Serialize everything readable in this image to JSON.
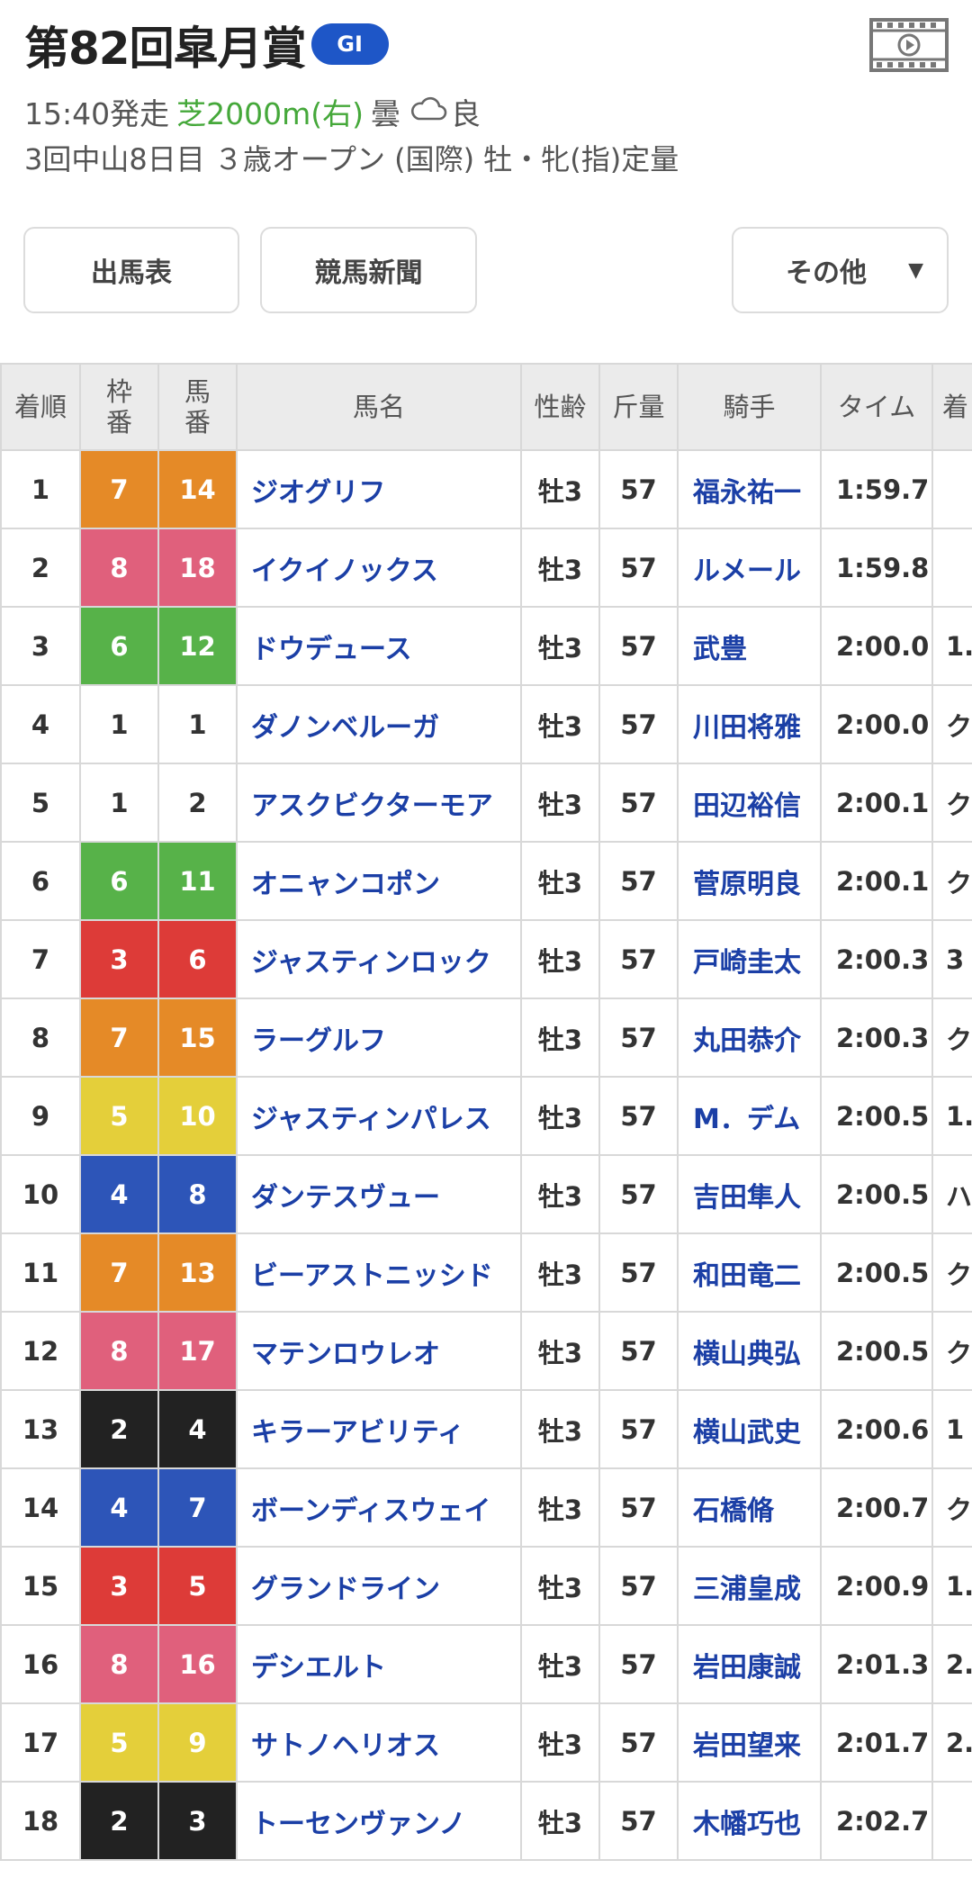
{
  "race": {
    "title": "第82回皐月賞",
    "grade": "GI",
    "start_time": "15:40発走",
    "course": "芝2000m(右)",
    "weather": "曇",
    "weather_icon": "cloud-icon",
    "track_condition": "良",
    "details": "3回中山8日目 ３歳オープン (国際) 牡・牝(指)定量"
  },
  "buttons": {
    "shutuba": "出馬表",
    "shinbun": "競馬新聞",
    "other": "その他",
    "other_caret": "▼"
  },
  "table": {
    "headers": {
      "order": "着順",
      "waku": "枠番",
      "num": "馬番",
      "horse": "馬名",
      "sexage": "性齢",
      "weight": "斤量",
      "jockey": "騎手",
      "time": "タイム",
      "margin": "着"
    },
    "waku_colors": {
      "1": "#ffffff",
      "2": "#222222",
      "3": "#dd3b38",
      "4": "#2d55b8",
      "5": "#e4cf3a",
      "6": "#57b249",
      "7": "#e58a27",
      "8": "#e0607c"
    },
    "rows": [
      {
        "order": "1",
        "waku": "7",
        "num": "14",
        "horse": "ジオグリフ",
        "sexage": "牡3",
        "weight": "57",
        "jockey": "福永祐一",
        "time": "1:59.7",
        "margin": ""
      },
      {
        "order": "2",
        "waku": "8",
        "num": "18",
        "horse": "イクイノックス",
        "sexage": "牡3",
        "weight": "57",
        "jockey": "ルメール",
        "time": "1:59.8",
        "margin": ""
      },
      {
        "order": "3",
        "waku": "6",
        "num": "12",
        "horse": "ドウデュース",
        "sexage": "牡3",
        "weight": "57",
        "jockey": "武豊",
        "time": "2:00.0",
        "margin": "1."
      },
      {
        "order": "4",
        "waku": "1",
        "num": "1",
        "horse": "ダノンベルーガ",
        "sexage": "牡3",
        "weight": "57",
        "jockey": "川田将雅",
        "time": "2:00.0",
        "margin": "ク"
      },
      {
        "order": "5",
        "waku": "1",
        "num": "2",
        "horse": "アスクビクターモア",
        "sexage": "牡3",
        "weight": "57",
        "jockey": "田辺裕信",
        "time": "2:00.1",
        "margin": "ク"
      },
      {
        "order": "6",
        "waku": "6",
        "num": "11",
        "horse": "オニャンコポン",
        "sexage": "牡3",
        "weight": "57",
        "jockey": "菅原明良",
        "time": "2:00.1",
        "margin": "ク"
      },
      {
        "order": "7",
        "waku": "3",
        "num": "6",
        "horse": "ジャスティンロック",
        "sexage": "牡3",
        "weight": "57",
        "jockey": "戸崎圭太",
        "time": "2:00.3",
        "margin": "3"
      },
      {
        "order": "8",
        "waku": "7",
        "num": "15",
        "horse": "ラーグルフ",
        "sexage": "牡3",
        "weight": "57",
        "jockey": "丸田恭介",
        "time": "2:00.3",
        "margin": "ク"
      },
      {
        "order": "9",
        "waku": "5",
        "num": "10",
        "horse": "ジャスティンパレス",
        "sexage": "牡3",
        "weight": "57",
        "jockey": "M．デム",
        "time": "2:00.5",
        "margin": "1."
      },
      {
        "order": "10",
        "waku": "4",
        "num": "8",
        "horse": "ダンテスヴュー",
        "sexage": "牡3",
        "weight": "57",
        "jockey": "吉田隼人",
        "time": "2:00.5",
        "margin": "ハ"
      },
      {
        "order": "11",
        "waku": "7",
        "num": "13",
        "horse": "ビーアストニッシド",
        "sexage": "牡3",
        "weight": "57",
        "jockey": "和田竜二",
        "time": "2:00.5",
        "margin": "ク"
      },
      {
        "order": "12",
        "waku": "8",
        "num": "17",
        "horse": "マテンロウレオ",
        "sexage": "牡3",
        "weight": "57",
        "jockey": "横山典弘",
        "time": "2:00.5",
        "margin": "ク"
      },
      {
        "order": "13",
        "waku": "2",
        "num": "4",
        "horse": "キラーアビリティ",
        "sexage": "牡3",
        "weight": "57",
        "jockey": "横山武史",
        "time": "2:00.6",
        "margin": "1"
      },
      {
        "order": "14",
        "waku": "4",
        "num": "7",
        "horse": "ボーンディスウェイ",
        "sexage": "牡3",
        "weight": "57",
        "jockey": "石橋脩",
        "time": "2:00.7",
        "margin": "ク"
      },
      {
        "order": "15",
        "waku": "3",
        "num": "5",
        "horse": "グランドライン",
        "sexage": "牡3",
        "weight": "57",
        "jockey": "三浦皇成",
        "time": "2:00.9",
        "margin": "1."
      },
      {
        "order": "16",
        "waku": "8",
        "num": "16",
        "horse": "デシエルト",
        "sexage": "牡3",
        "weight": "57",
        "jockey": "岩田康誠",
        "time": "2:01.3",
        "margin": "2."
      },
      {
        "order": "17",
        "waku": "5",
        "num": "9",
        "horse": "サトノヘリオス",
        "sexage": "牡3",
        "weight": "57",
        "jockey": "岩田望来",
        "time": "2:01.7",
        "margin": "2."
      },
      {
        "order": "18",
        "waku": "2",
        "num": "3",
        "horse": "トーセンヴァンノ",
        "sexage": "牡3",
        "weight": "57",
        "jockey": "木幡巧也",
        "time": "2:02.7",
        "margin": ""
      }
    ]
  }
}
